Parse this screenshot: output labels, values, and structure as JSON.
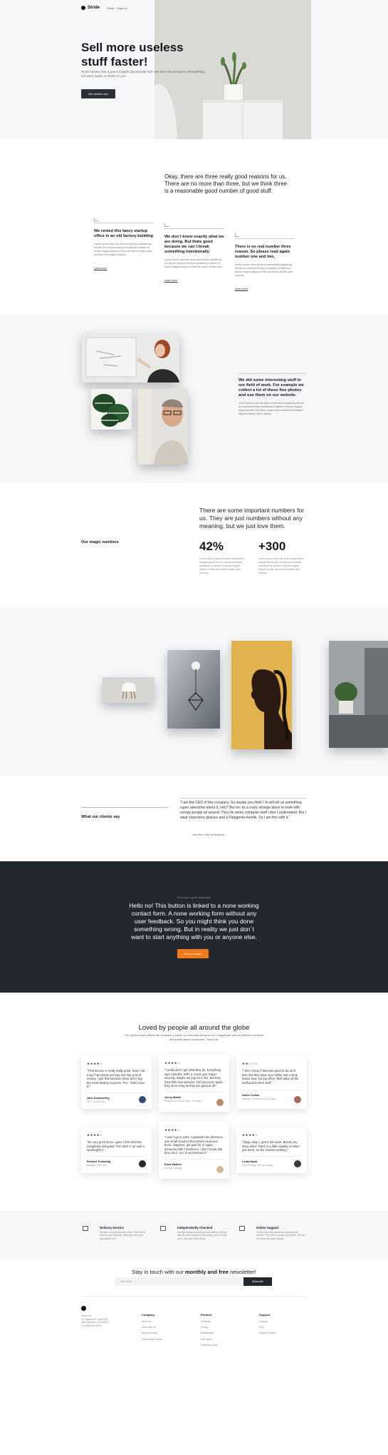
{
  "brand": {
    "name": "Stride"
  },
  "nav": {
    "label": "Stride · Pages ▾"
  },
  "hero": {
    "title": "Sell more useless stuff faster!",
    "text": "To be honest, this is just a longish placeholder text. We don't know how to sell anything, not even music or shoes or you.",
    "button": "Get started now"
  },
  "reasons": {
    "title": "Okay, there are three really good reasons for us. There are no more than three, but we think three is a reasonable good number of good stuff.",
    "cards": [
      {
        "title": "We rented this fancy startup office in an old factory building",
        "text": "Lorem ipsum dolor sit amet consectetur adipiscing elit sed do eiusmod tempor incididunt ut labore et dolore magna aliqua ut enim ad minim veniam quis nostrud exercitation ullamco.",
        "link": "Learn more"
      },
      {
        "title": "We don´t know exactly what we are doing. But thats good because we can´t break something intentionally.",
        "text": "Lorem ipsum dolor sit amet consectetur adipiscing elit sed do eiusmod tempor incididunt ut labore et dolore magna aliqua ut enim ad minim veniam quis.",
        "link": "Learn more"
      },
      {
        "title": "There is no real number three reason. So please read again number one and two.",
        "text": "Lorem ipsum dolor sit amet consectetur adipiscing elit sed do eiusmod tempor incididunt ut labore et dolore magna aliqua ut enim ad minim veniam quis nostrud.",
        "link": "Learn more"
      }
    ]
  },
  "story": {
    "title": "We did some interesting stuff in our field of work. For example we collect a lot of these fine photos and use them on our website.",
    "text": "Lorem ipsum dolor sit amet consectetur adipiscing elit sed do eiusmod tempor incididunt ut labore et dolore magna aliqua ut enim ad minim veniam quis nostrud exercitation ullamco laboris nisi ut aliquip."
  },
  "numbers": {
    "label": "Our magic numbers",
    "title": "There are some important numbers for us. They are just numbers without any meaning, but we just love them.",
    "items": [
      {
        "value": "42%",
        "text": "Lorem ipsum dolor sit amet consectetur adipiscing elit sed do eiusmod tempor incididunt ut labore et dolore magna aliqua ut enim ad minim veniam quis nostrud."
      },
      {
        "value": "+300",
        "text": "Lorem ipsum dolor sit amet consectetur adipiscing elit sed do eiusmod tempor incididunt ut labore et dolore magna aliqua ut enim ad minim veniam quis nostrud."
      }
    ]
  },
  "testimonial": {
    "label": "What our clients say",
    "quote": "\"I am the CEO of this company. So maybe you think I´m will tell us something super awesome about it, only? But no: its a crazy strange place to work with creepy people all around. They do some computer stuff i don´t understand. But I wear expensive glasses and a Patagonia-hoodie. So I am fine with it.\"",
    "author": "John Doe, CEO at Stride Inc."
  },
  "cta": {
    "small": "Let´s start a good relationship",
    "text": "Hello no! This button is linked to a none working contact form. A none working form without any user feedback. So you might think you done something wrong. But in reality we just don´t want to start anything with you or anyone else.",
    "button": "Get in contact"
  },
  "loved": {
    "title": "Loved by people all around the globe",
    "subtitle": "Our opinions and efforts are constant. Luckily, our interests will grow on a magnitude without attention at these thousands awful consumers. Thank us!",
    "cards": [
      {
        "stars": "★★★★☆",
        "quote": "\"That service is really really good. Now I eat 3 kg l-hat blonde per tray and hair a lot of money. I just first because these don´t buy the most destroy anymore. P.S.: Yeah I love it.\"",
        "name": "Jane Doneworthy",
        "role": "CEO, Goods Corp"
      },
      {
        "stars": "★★★★☆",
        "quote": "\"I really didn´t get what they do. Everything was colourful. Wtf? a. Good your Super Security. Maybe we pay for it fine. But they have little nice pictures. Ok how many spare they do so long as they are good at all.\"",
        "name": "Jenny Martin",
        "role": "Designer at Ink and Paper, Germany"
      },
      {
        "stars": "★★☆☆☆",
        "quote": "\"I don´t know if that was good to do all of that. But they have nice coffee and a shop based near out top office. Well allow all the stuff and do their stuff.\"",
        "name": "Karlie Collins",
        "role": "Manager, Somewhere in Chicago"
      },
      {
        "stars": "★★★★☆",
        "quote": "\"So very good since i gave it first shot but completely disrupted. The CEO´s car was a lamborghini.\"",
        "name": "Richard Trembling",
        "role": "Manager, New York"
      },
      {
        "stars": "★★★★☆",
        "quote": "\"I won´t go to work. I uploaded the photos to one small cloud so that others could see them. Happens, get paid for it. Again, someone didn´t mention it. I don´t know that they ran it, so I´d recommend it.\"",
        "name": "Rosa Walters",
        "role": "Director, Chicago"
      },
      {
        "stars": "★★★★☆",
        "quote": "\"Okay, okay. I give it five stars. But do you know what: There is a little mistake of what i just hired. So the reviews nothing.\"",
        "name": "Linda Hawk",
        "role": "Lead Strategy, Spruce Industry"
      }
    ]
  },
  "features": [
    {
      "icon": "box-icon",
      "title": "Delivery Service",
      "text": "We ship our products world wide. Feel free to send us your inquiries. Seriously, this is just placeholder text."
    },
    {
      "icon": "card-icon",
      "title": "Independently Checked",
      "text": "Nobody checked anything independently. We just want to look trustworthy. Everything here is made up for the sake of this demo."
    },
    {
      "icon": "chat-icon",
      "title": "Online Support",
      "text": "Do you have any questions regarding this service? Feel free to contact us anytime. We are not really reachable though."
    }
  ],
  "newsletter": {
    "prefix": "Stay in touch with our ",
    "bold": "monthly and free",
    "suffix": " newsletter!",
    "placeholder": "Your email",
    "button": "Subscribe"
  },
  "footer": {
    "address": [
      "Stride Inc.",
      "123 Market St. Suite 100",
      "San Francisco, CA 94103",
      "(+1) 555 234 5678"
    ],
    "columns": [
      {
        "title": "Company",
        "links": [
          "About us",
          "Work with us",
          "Blog and news",
          "Community Events"
        ]
      },
      {
        "title": "Product",
        "links": [
          "Features",
          "Pricing",
          "Marketplace",
          "Use cases",
          "Developer docs"
        ]
      },
      {
        "title": "Support",
        "links": [
          "Contact",
          "FAQ",
          "Support Center"
        ]
      }
    ]
  },
  "colors": {
    "accent": "#f07b1a",
    "dark": "#23272e",
    "light_bg": "#f6f7f9"
  }
}
